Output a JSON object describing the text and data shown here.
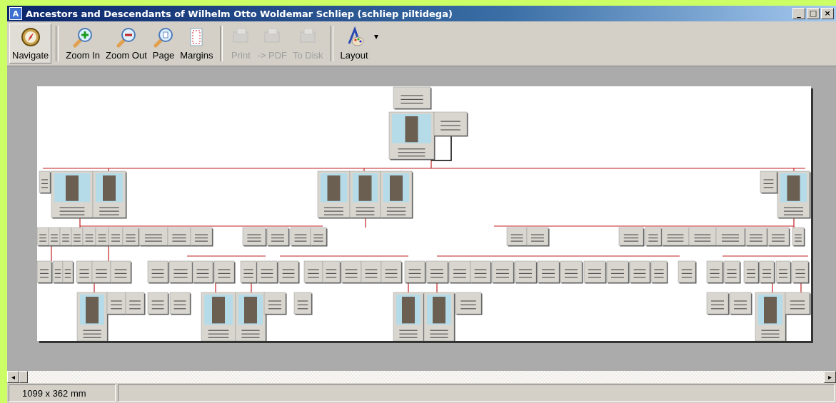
{
  "window": {
    "title": "Ancestors and Descendants of Wilhelm Otto Woldemar Schliep (schliep piltidega)",
    "controls": [
      "_",
      "□",
      "×"
    ],
    "app_icon": "A"
  },
  "toolbar": {
    "groups": [
      [
        {
          "label": "Navigate",
          "selected": true,
          "disabled": false
        }
      ],
      [
        {
          "label": "Zoom In",
          "selected": false,
          "disabled": false
        },
        {
          "label": "Zoom Out",
          "selected": false,
          "disabled": false
        },
        {
          "label": "Page",
          "selected": false,
          "disabled": false
        },
        {
          "label": "Margins",
          "selected": false,
          "disabled": false
        }
      ],
      [
        {
          "label": "Print",
          "selected": false,
          "disabled": true
        },
        {
          "label": "-> PDF",
          "selected": false,
          "disabled": true
        },
        {
          "label": "To Disk",
          "selected": false,
          "disabled": true
        }
      ],
      [
        {
          "label": "Layout",
          "selected": false,
          "disabled": false
        }
      ]
    ],
    "dropdown": "▾"
  },
  "scrollbar": {
    "left": "◂",
    "right": "▸"
  },
  "status_bar": {
    "size": "1099 x 362 mm"
  }
}
